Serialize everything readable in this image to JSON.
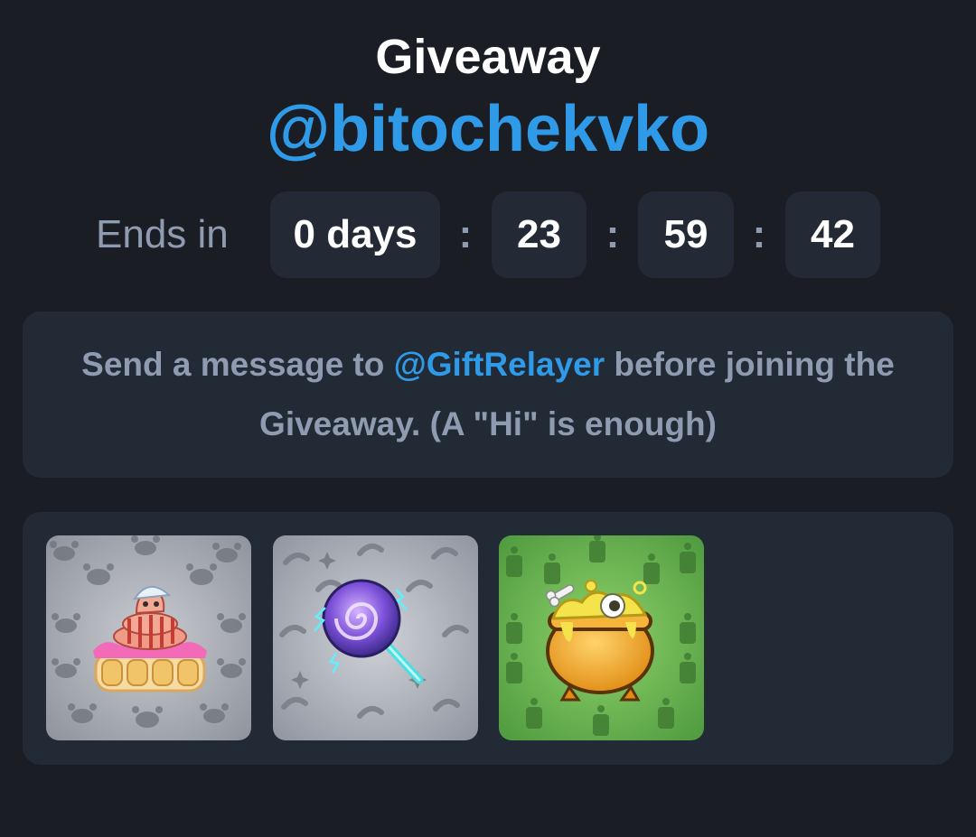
{
  "header": {
    "title": "Giveaway",
    "channel": "@bitochekvko"
  },
  "countdown": {
    "label": "Ends in",
    "days": "0 days",
    "hours": "23",
    "minutes": "59",
    "seconds": "42",
    "separator": ":"
  },
  "notice": {
    "prefix": "Send a message to ",
    "link": "@GiftRelayer",
    "suffix": " before joining the Giveaway. (A \"Hi\" is enough)"
  },
  "gifts": {
    "items": [
      {
        "icon": "snake-on-2025-cake-gift",
        "background": "#a9acb3"
      },
      {
        "icon": "lollipop-gift",
        "background": "#a9acb3"
      },
      {
        "icon": "cauldron-gift",
        "background": "#5aa84a"
      }
    ]
  },
  "colors": {
    "background": "#1a1d24",
    "card": "#222a35",
    "accent": "#2f9be8",
    "muted_text": "#8f9bb0"
  }
}
